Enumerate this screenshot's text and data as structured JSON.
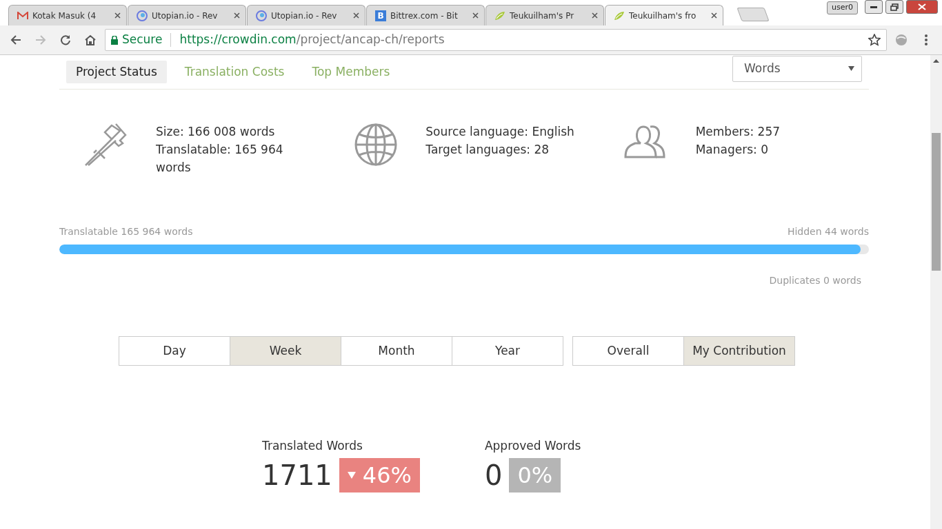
{
  "browser": {
    "tabs": [
      {
        "title": "Kotak Masuk (4",
        "kind": "mail",
        "selected": false
      },
      {
        "title": "Utopian.io - Rev",
        "kind": "swirl",
        "selected": false
      },
      {
        "title": "Utopian.io - Rev",
        "kind": "swirl",
        "selected": false
      },
      {
        "title": "Bittrex.com - Bit",
        "kind": "letter",
        "icon_text": "B",
        "selected": false
      },
      {
        "title": "Teukuilham's Pr",
        "kind": "leaf",
        "selected": false
      },
      {
        "title": "Teukuilham's fro",
        "kind": "leaf",
        "selected": true
      }
    ],
    "profile": "user0",
    "secure_label": "Secure",
    "url": {
      "host": "https://crowdin.com",
      "path": "/project/ancap-ch/reports"
    }
  },
  "report_tabs": [
    {
      "label": "Project Status",
      "selected": true
    },
    {
      "label": "Translation Costs",
      "selected": false
    },
    {
      "label": "Top Members",
      "selected": false
    }
  ],
  "unit_select": {
    "value": "Words"
  },
  "summary": [
    {
      "kind": "calipers",
      "lines": [
        "Size: 166 008 words",
        "Translatable: 165 964 words"
      ]
    },
    {
      "kind": "globe",
      "lines": [
        "Source language: English",
        "Target languages: 28"
      ]
    },
    {
      "kind": "users",
      "lines": [
        "Members: 257",
        "Managers: 0"
      ]
    }
  ],
  "progress": {
    "left_label": "Translatable 165 964 words",
    "right_label": "Hidden 44 words",
    "level": 0.99,
    "note": "Duplicates 0 words"
  },
  "periods": [
    {
      "label": "Day",
      "selected": false
    },
    {
      "label": "Week",
      "selected": true
    },
    {
      "label": "Month",
      "selected": false
    },
    {
      "label": "Year",
      "selected": false
    }
  ],
  "scopes": [
    {
      "label": "Overall",
      "selected": false
    },
    {
      "label": "My Contribution",
      "selected": true
    }
  ],
  "stats": [
    {
      "label": "Translated Words",
      "value": "1711",
      "change": "46%",
      "kind": "down"
    },
    {
      "label": "Approved Words",
      "value": "0",
      "change": "0%",
      "kind": "none"
    }
  ]
}
